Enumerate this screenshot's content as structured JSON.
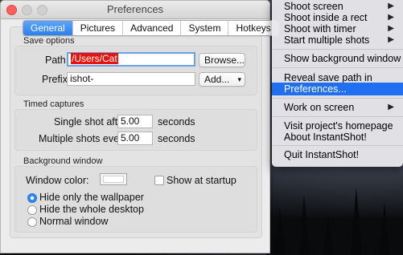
{
  "window": {
    "title": "Preferences",
    "tabs": [
      "General",
      "Pictures",
      "Advanced",
      "System",
      "Hotkeys"
    ]
  },
  "save_options": {
    "label": "Save options",
    "path_label": "Path",
    "path_value": "/Users/Cat",
    "browse_button": "Browse...",
    "prefix_label": "Prefix",
    "prefix_value": "ishot-",
    "add_button": "Add..."
  },
  "timed_captures": {
    "label": "Timed captures",
    "single_label": "Single shot after",
    "single_value": "5.00",
    "single_unit": "seconds",
    "multiple_label": "Multiple shots every",
    "multiple_value": "5.00",
    "multiple_unit": "seconds"
  },
  "background_window": {
    "label": "Background window",
    "color_label": "Window color:",
    "show_at_startup": "Show at startup",
    "options": [
      "Hide only the wallpaper",
      "Hide the whole desktop",
      "Normal window"
    ],
    "selected": "Hide only the wallpaper"
  },
  "menu": {
    "items": [
      "Shoot screen",
      "Shoot inside a rect",
      "Shoot with timer",
      "Start multiple shots",
      "Show background window",
      "Reveal save path in Finder",
      "Preferences...",
      "Work on screen",
      "Visit project's homepage",
      "About InstantShot!",
      "Quit InstantShot!"
    ],
    "highlighted": "Preferences..."
  },
  "colors": {
    "accent": "#2a7ff0",
    "menu_highlight": "#1f6ff0",
    "path_highlight": "#e8130d"
  }
}
